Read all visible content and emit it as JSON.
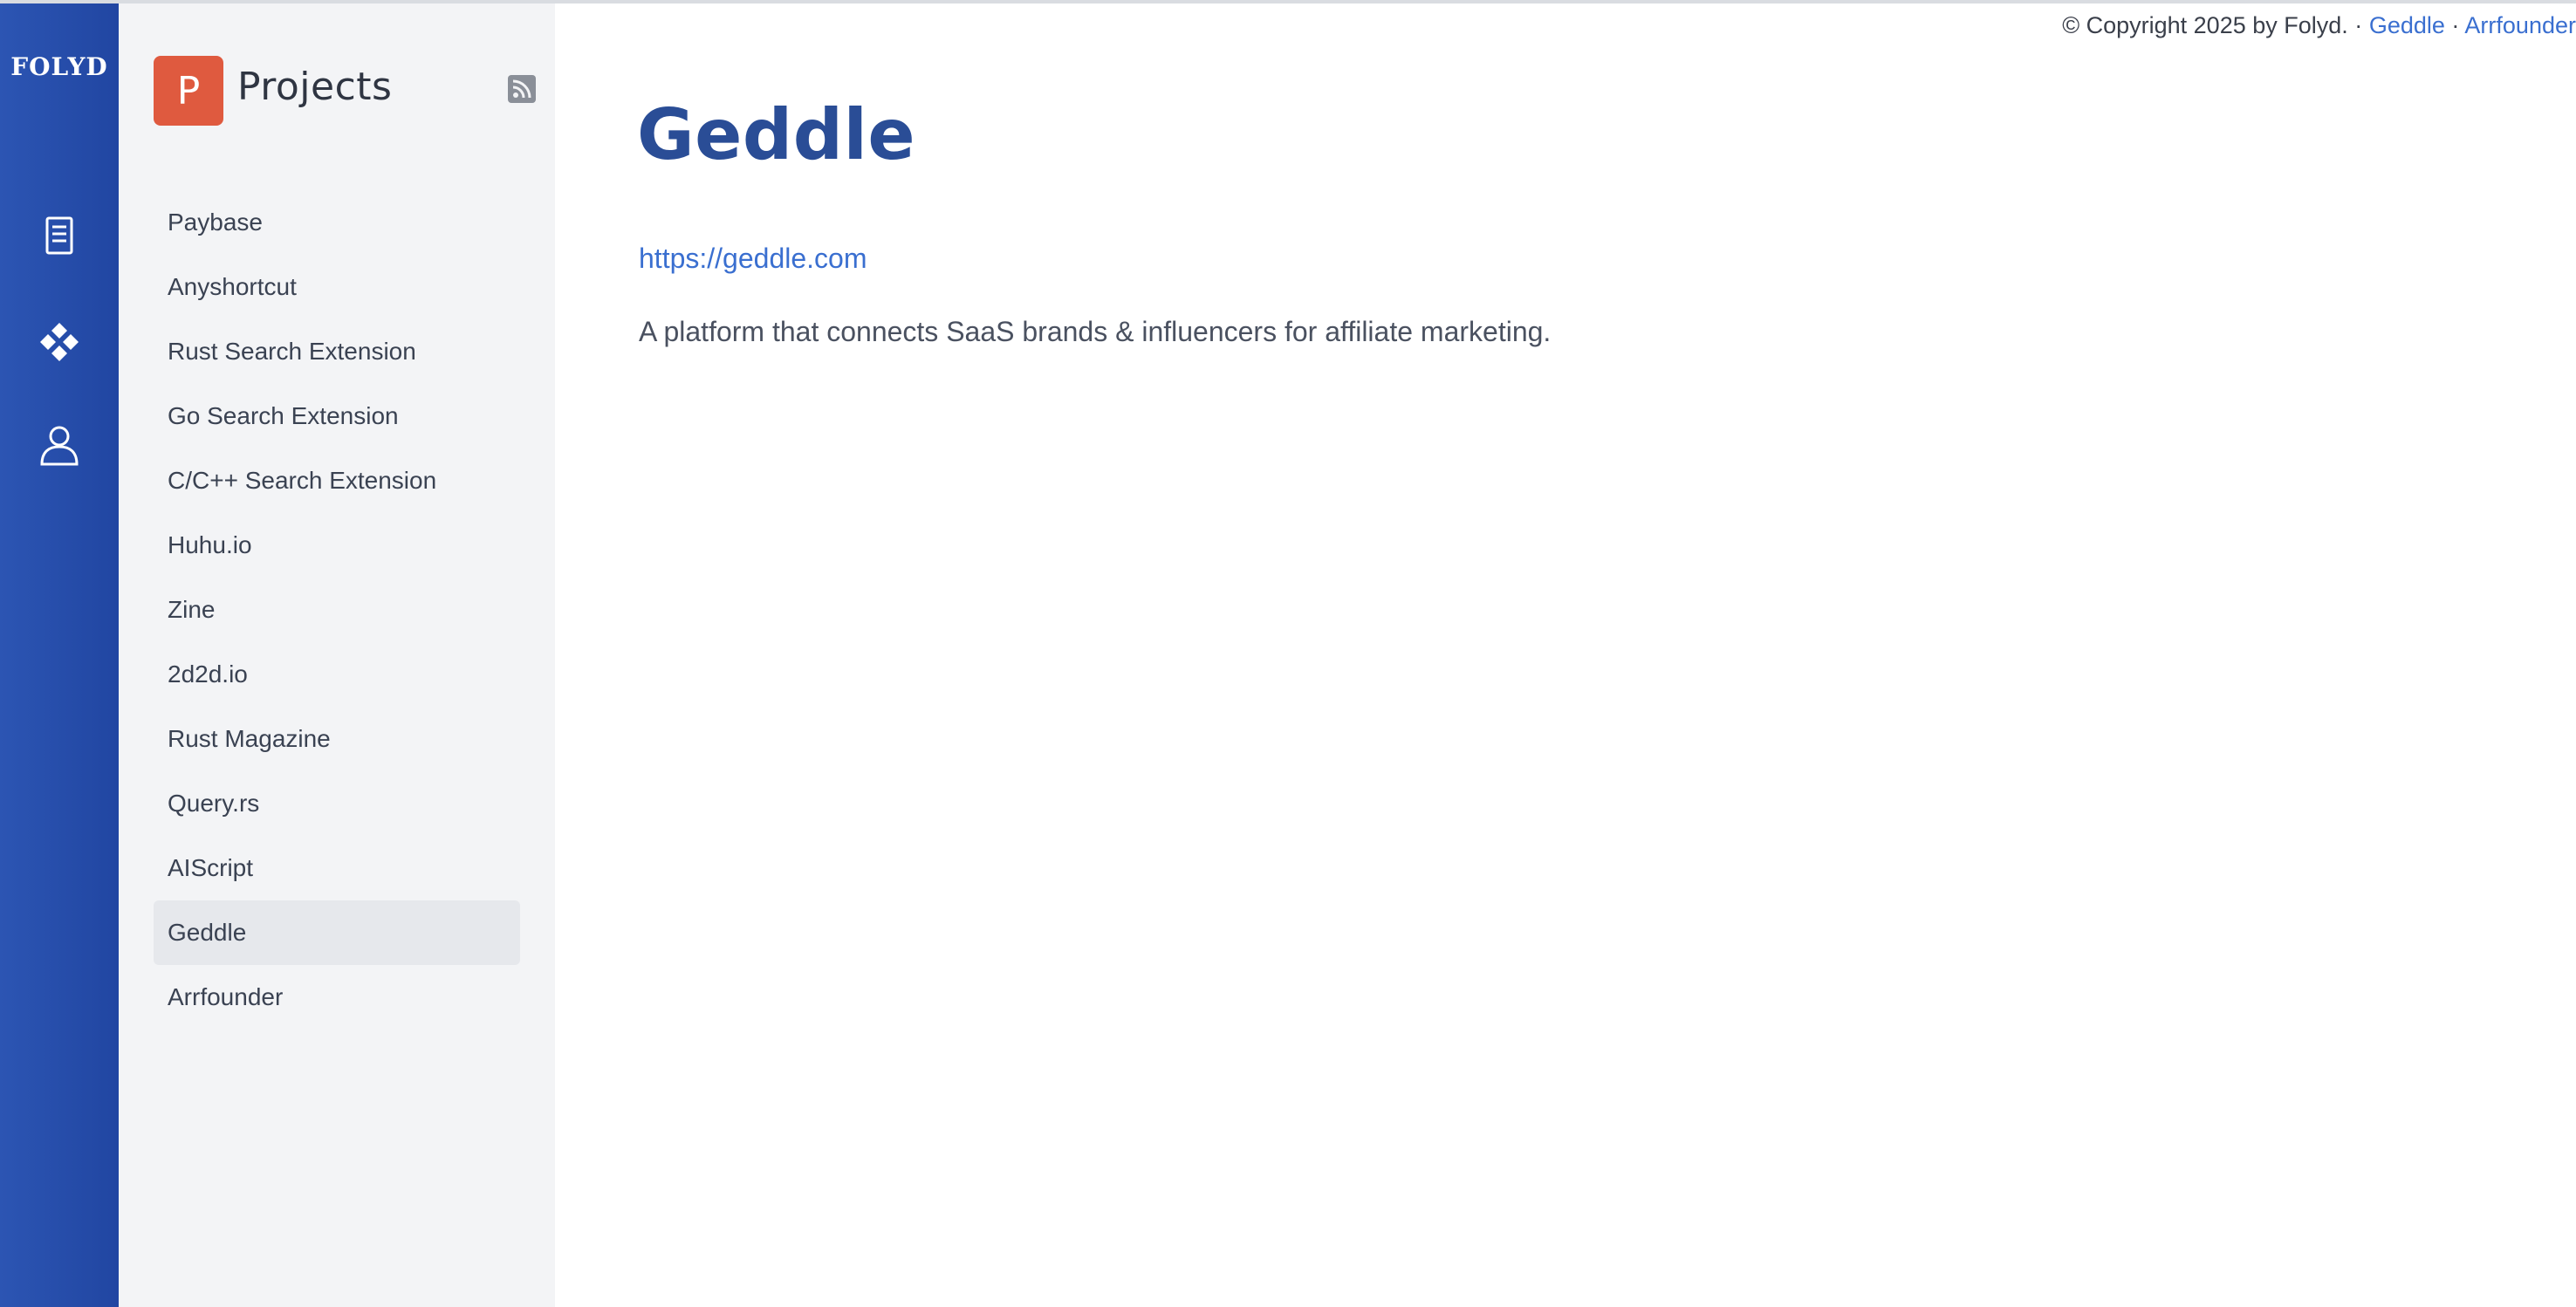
{
  "brand": "FOLYD",
  "rail": {
    "icons": [
      "document-icon",
      "diamond-grid-icon",
      "user-icon"
    ]
  },
  "sidebar": {
    "logo_letter": "P",
    "title": "Projects",
    "rss_icon": "rss-icon",
    "items": [
      {
        "label": "Paybase"
      },
      {
        "label": "Anyshortcut"
      },
      {
        "label": "Rust Search Extension"
      },
      {
        "label": "Go Search Extension"
      },
      {
        "label": "C/C++ Search Extension"
      },
      {
        "label": "Huhu.io"
      },
      {
        "label": "Zine"
      },
      {
        "label": "2d2d.io"
      },
      {
        "label": "Rust Magazine"
      },
      {
        "label": "Query.rs"
      },
      {
        "label": "AIScript"
      },
      {
        "label": "Geddle"
      },
      {
        "label": "Arrfounder"
      }
    ],
    "active": "Geddle"
  },
  "footer": {
    "copyright": "© Copyright 2025 by Folyd.",
    "sep": "·",
    "links": [
      "Geddle",
      "Arrfounder"
    ]
  },
  "main": {
    "title": "Geddle",
    "url": "https://geddle.com",
    "description": "A platform that connects SaaS brands & influencers for affiliate marketing."
  },
  "colors": {
    "rail": "#2146a2",
    "sidebar_bg": "#f3f4f6",
    "logo": "#df5a3f",
    "title": "#2a4d96",
    "link": "#3a6fd0"
  }
}
